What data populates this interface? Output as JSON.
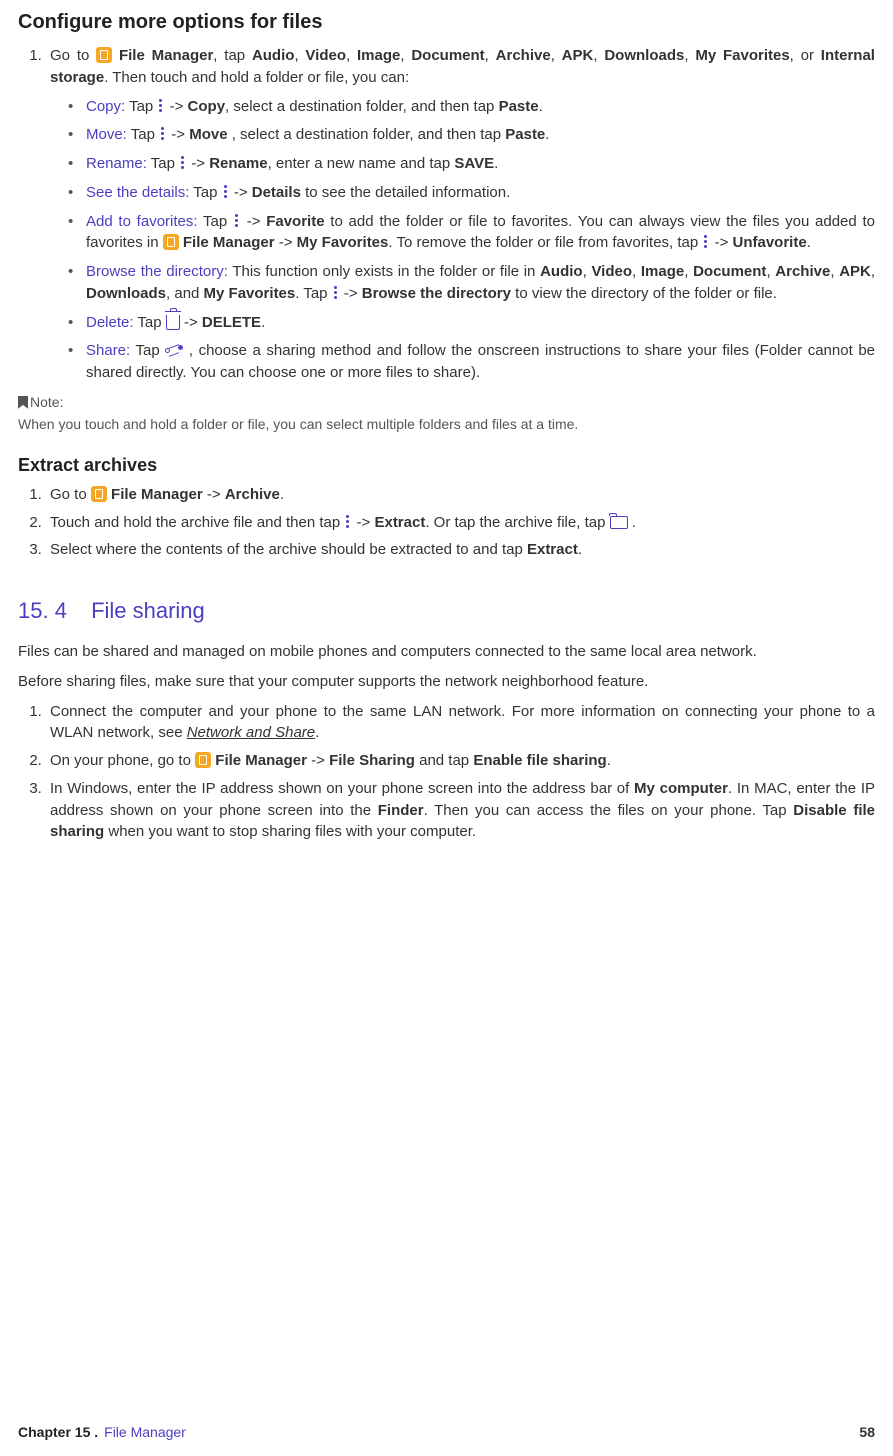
{
  "s1": {
    "title": "Configure more options for files",
    "step1_a": "Go to ",
    "step1_fm": "File Manager",
    "step1_b": ", tap ",
    "step1_c": ", or ",
    "step1_int": "Internal storage",
    "step1_d": ". Then touch and hold a folder or file, you can:",
    "cats": {
      "a": "Audio",
      "v": "Video",
      "i": "Image",
      "d": "Document",
      "ar": "Archive",
      "ap": "APK",
      "dl": "Downloads",
      "mf": "My Favorites"
    },
    "copy": {
      "k": "Copy:",
      "a": " Tap ",
      "b": " -> ",
      "c": "Copy",
      "d": ", select a destination folder, and then tap ",
      "e": "Paste",
      "f": "."
    },
    "move": {
      "k": "Move:",
      "a": " Tap ",
      "b": " -> ",
      "c": "Move ",
      "d": ", select a destination folder, and then tap ",
      "e": "Paste",
      "f": "."
    },
    "ren": {
      "k": "Rename:",
      "a": " Tap ",
      "b": " -> ",
      "c": "Rename",
      "d": ", enter a new name and tap ",
      "e": "SAVE",
      "f": "."
    },
    "det": {
      "k": "See the details:",
      "a": " Tap ",
      "b": " -> ",
      "c": "Details",
      "d": " to see the detailed information."
    },
    "fav": {
      "k": "Add to favorites:",
      "a": " Tap ",
      "b": " -> ",
      "c": "Favorite",
      "d": " to add the folder or file to favorites. You can always view the files you added to favorites in ",
      "fm": "File Manager",
      "e": " -> ",
      "mf": "My Favorites",
      "f": ". To remove the folder or file from favorites, tap ",
      "g": " -> ",
      "un": "Unfavorite",
      "h": "."
    },
    "brw": {
      "k": "Browse the directory:",
      "a": " This function only exists in the folder or file in ",
      "b": ", and ",
      "c": ". Tap ",
      "d": " -> ",
      "e": "Browse the directory",
      "f": " to view the directory of the folder or file."
    },
    "del": {
      "k": "Delete:",
      "a": " Tap ",
      "b": " -> ",
      "c": "DELETE",
      "d": "."
    },
    "shr": {
      "k": "Share:",
      "a": " Tap ",
      "b": " , choose a sharing method and follow the onscreen instructions to share your files (Folder cannot be shared directly. You can choose one or more files to share)."
    },
    "note_lbl": "Note:",
    "note": "When you touch and hold a folder or file, you can select multiple folders and files at a time."
  },
  "s2": {
    "title": "Extract archives",
    "l1": {
      "a": "Go to ",
      "fm": "File Manager",
      "b": " -> ",
      "c": "Archive",
      "d": "."
    },
    "l2": {
      "a": "Touch and hold the archive file and then tap ",
      "b": " -> ",
      "c": "Extract",
      "d": ". Or tap the archive file, tap ",
      "e": " ."
    },
    "l3": {
      "a": "Select where the contents of the archive should be extracted to and tap ",
      "b": "Extract",
      "c": "."
    }
  },
  "s3": {
    "num": "15. 4",
    "title": "File sharing",
    "p1": "Files can be shared and managed on mobile phones and computers connected to the same local area network.",
    "p2": "Before sharing files, make sure that your computer supports the network neighborhood feature.",
    "l1": {
      "a": "Connect the computer and your phone to the same LAN network. For more information on connecting your phone to a WLAN network, see ",
      "lnk": "Network and Share",
      "b": "."
    },
    "l2": {
      "a": "On your phone, go to ",
      "fm": "File Manager",
      "b": " -> ",
      "fs": "File Sharing",
      "c": " and tap ",
      "en": "Enable file sharing",
      "d": "."
    },
    "l3": {
      "a": "In Windows, enter the IP address shown on your phone screen into the address bar of ",
      "mc": "My computer",
      "b": ". In MAC, enter the IP address shown on your phone screen into the ",
      "fn": "Finder",
      "c": ". Then you can access the files on your phone. Tap ",
      "ds": "Disable file sharing",
      "d": " when you want to stop sharing files with your computer."
    }
  },
  "footer": {
    "ch": "Chapter 15 .",
    "name": "File Manager",
    "page": "58"
  }
}
